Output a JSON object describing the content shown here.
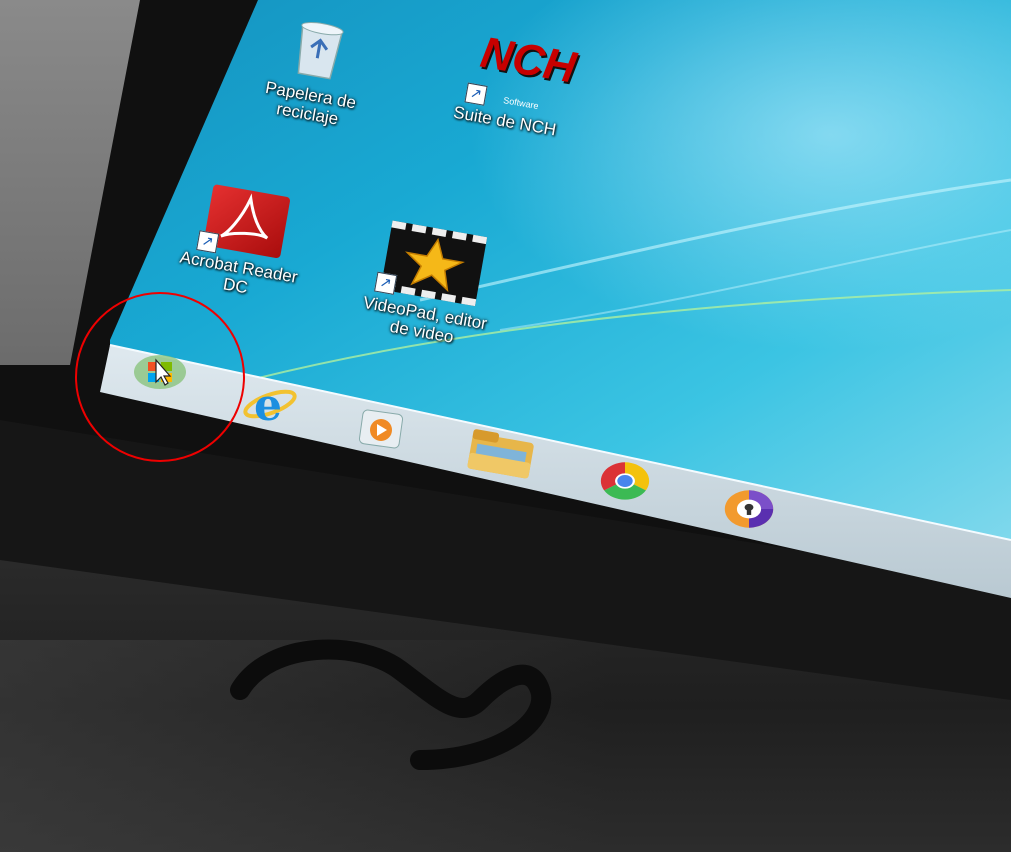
{
  "desktop": {
    "icons": [
      {
        "label_line1": "Papelera de",
        "label_line2": "reciclaje",
        "icon": "recycle-bin-icon"
      },
      {
        "label_line1": "Suite de NCH",
        "label_line2": "",
        "icon": "nch-suite-icon",
        "logo_text": "NCH",
        "logo_sub": "Software"
      },
      {
        "label_line1": "Acrobat Reader",
        "label_line2": "DC",
        "icon": "acrobat-reader-icon"
      },
      {
        "label_line1": "VideoPad, editor",
        "label_line2": "de video",
        "icon": "videopad-icon"
      }
    ]
  },
  "taskbar": {
    "items": [
      {
        "icon": "windows-start-icon"
      },
      {
        "icon": "internet-explorer-icon"
      },
      {
        "icon": "media-player-icon"
      },
      {
        "icon": "file-explorer-icon"
      },
      {
        "icon": "chrome-icon"
      },
      {
        "icon": "browser-shield-icon"
      }
    ]
  },
  "colors": {
    "desktop_bg": "#1aa7cf",
    "annotation_circle": "#e00000"
  }
}
